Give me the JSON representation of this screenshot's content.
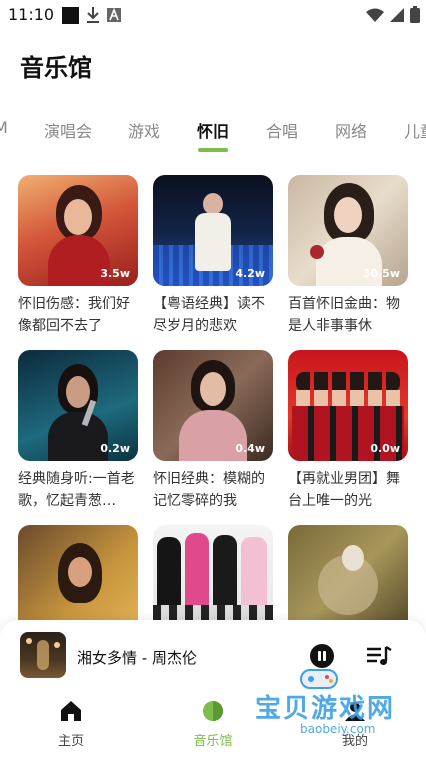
{
  "status_bar": {
    "time": "11:10",
    "icons": [
      "notification-square-icon",
      "download-icon",
      "font-a-icon",
      "wifi-icon",
      "signal-icon",
      "battery-icon"
    ]
  },
  "header": {
    "title": "音乐馆"
  },
  "tabs": [
    "M",
    "演唱会",
    "游戏",
    "怀旧",
    "合唱",
    "网络",
    "儿童"
  ],
  "active_tab": "怀旧",
  "cards": [
    {
      "title": "怀旧伤感：我们好像都回不去了",
      "count": "3.5w"
    },
    {
      "title": "【粤语经典】读不尽岁月的悲欢",
      "count": "4.2w"
    },
    {
      "title": "百首怀旧金曲：物是人非事事休",
      "count": "30.5w"
    },
    {
      "title": "经典随身听:一首老歌，忆起青葱…",
      "count": "0.2w"
    },
    {
      "title": "怀旧经典：模糊的记忆零碎的我",
      "count": "0.4w"
    },
    {
      "title": "【再就业男团】舞台上唯一的光",
      "count": "0.0w"
    },
    {
      "title": "",
      "count": ""
    },
    {
      "title": "",
      "count": ""
    },
    {
      "title": "",
      "count": ""
    }
  ],
  "player": {
    "now_playing": "湘女多情 - 周杰伦"
  },
  "bottom_nav": [
    {
      "label": "主页",
      "icon": "home-icon"
    },
    {
      "label": "音乐馆",
      "icon": "music-hall-icon"
    },
    {
      "label": "我的",
      "icon": "profile-icon"
    }
  ],
  "watermark": {
    "text": "宝贝游戏网",
    "url": "baobeiy.com"
  },
  "colors": {
    "accent": "#7cbd4c",
    "text": "#111111",
    "muted": "#888888"
  }
}
